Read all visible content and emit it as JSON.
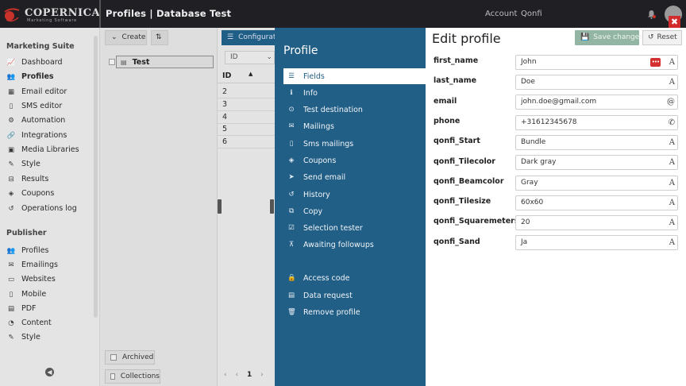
{
  "topbar": {
    "brand": "COPERNICA",
    "brand_sub": "Marketing Software",
    "page_title": "Profiles | Database Test",
    "account_link": "Account",
    "qonfi_link": "Qonfi",
    "close": "✖"
  },
  "sidebar": {
    "section1": "Marketing Suite",
    "items1": [
      {
        "label": "Dashboard",
        "icon": "chart-icon"
      },
      {
        "label": "Profiles",
        "icon": "users-icon"
      },
      {
        "label": "Email editor",
        "icon": "grid-icon"
      },
      {
        "label": "SMS editor",
        "icon": "mobile-icon"
      },
      {
        "label": "Automation",
        "icon": "gears-icon"
      },
      {
        "label": "Integrations",
        "icon": "link-icon"
      },
      {
        "label": "Media Libraries",
        "icon": "image-icon"
      },
      {
        "label": "Style",
        "icon": "brush-icon"
      },
      {
        "label": "Results",
        "icon": "inbox-icon"
      },
      {
        "label": "Coupons",
        "icon": "tag-icon"
      },
      {
        "label": "Operations log",
        "icon": "history-icon"
      }
    ],
    "section2": "Publisher",
    "items2": [
      {
        "label": "Profiles",
        "icon": "users-icon"
      },
      {
        "label": "Emailings",
        "icon": "envelope-icon"
      },
      {
        "label": "Websites",
        "icon": "monitor-icon"
      },
      {
        "label": "Mobile",
        "icon": "mobile-icon"
      },
      {
        "label": "PDF",
        "icon": "pdf-icon"
      },
      {
        "label": "Content",
        "icon": "rss-icon"
      },
      {
        "label": "Style",
        "icon": "brush-icon"
      }
    ],
    "collapse": "◀"
  },
  "listpanel": {
    "create": "Create",
    "sort": "⇅",
    "test_row": "Test",
    "archived": "Archived",
    "collections": "Collections"
  },
  "tablepanel": {
    "configure": "Configuratie",
    "id_select": "ID",
    "header": "ID",
    "rows": [
      "2",
      "3",
      "4",
      "5",
      "6"
    ],
    "page": "1"
  },
  "profile_nav": {
    "title": "Profile",
    "items": [
      {
        "label": "Fields",
        "icon": "list-icon"
      },
      {
        "label": "Info",
        "icon": "info-icon"
      },
      {
        "label": "Test destination",
        "icon": "target-icon"
      },
      {
        "label": "Mailings",
        "icon": "envelope-icon"
      },
      {
        "label": "Sms mailings",
        "icon": "mobile-icon"
      },
      {
        "label": "Coupons",
        "icon": "tag-icon"
      },
      {
        "label": "Send email",
        "icon": "send-icon"
      },
      {
        "label": "History",
        "icon": "history-icon"
      },
      {
        "label": "Copy",
        "icon": "copy-icon"
      },
      {
        "label": "Selection tester",
        "icon": "check-square-icon"
      },
      {
        "label": "Awaiting followups",
        "icon": "sitemap-icon"
      }
    ],
    "items_bottom": [
      {
        "label": "Access code",
        "icon": "lock-icon"
      },
      {
        "label": "Data request",
        "icon": "document-icon"
      },
      {
        "label": "Remove profile",
        "icon": "trash-icon"
      }
    ]
  },
  "edit": {
    "title": "Edit profile",
    "save": "Save changes",
    "reset": "Reset",
    "fields": [
      {
        "label": "first_name",
        "value": "John",
        "suffix": "A"
      },
      {
        "label": "last_name",
        "value": "Doe",
        "suffix": "A"
      },
      {
        "label": "email",
        "value": "john.doe@gmail.com",
        "suffix": "@"
      },
      {
        "label": "phone",
        "value": "+31612345678",
        "suffix": "✆"
      },
      {
        "label": "qonfi_Start",
        "value": "Bundle",
        "suffix": "A"
      },
      {
        "label": "qonfi_Tilecolor",
        "value": "Dark gray",
        "suffix": "A"
      },
      {
        "label": "qonfi_Beamcolor",
        "value": "Gray",
        "suffix": "A"
      },
      {
        "label": "qonfi_Tilesize",
        "value": "60x60",
        "suffix": "A"
      },
      {
        "label": "qonfi_Squaremeters",
        "value": "20",
        "suffix": "A"
      },
      {
        "label": "qonfi_Sand",
        "value": "Ja",
        "suffix": "A"
      }
    ]
  },
  "colors": {
    "topbar": "#1f1f24",
    "panel_blue": "#225f86",
    "accent_red": "#d12b2b",
    "save_green": "#93b5a4"
  }
}
